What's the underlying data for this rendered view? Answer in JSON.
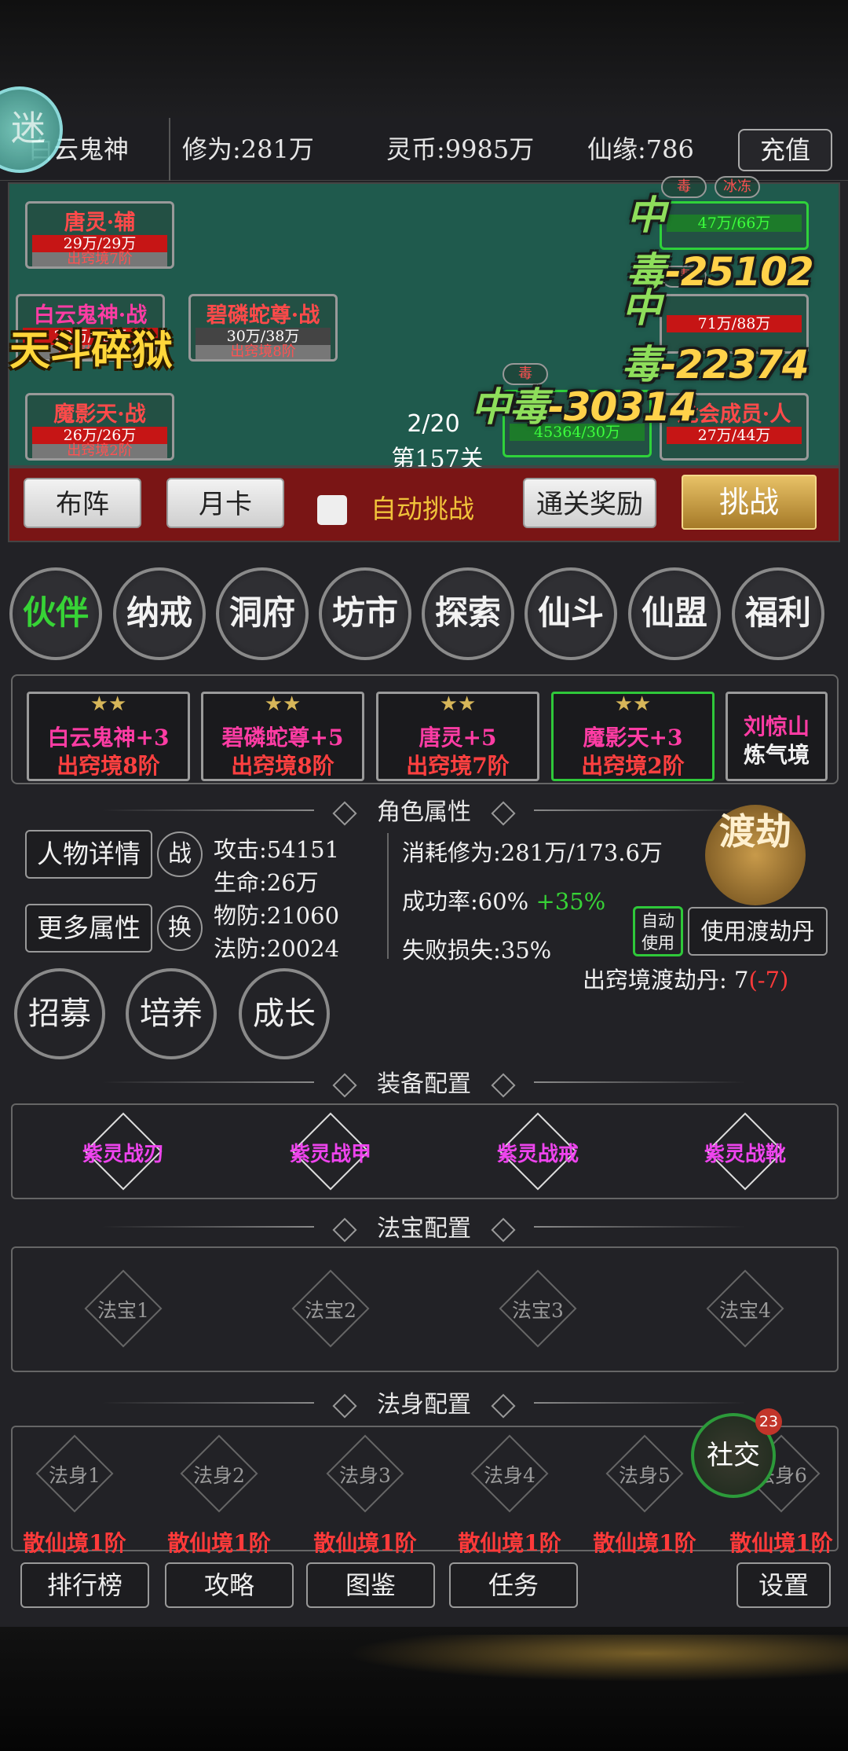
{
  "topbar": {
    "player_name": "白云鬼神",
    "cultivation": "修为:281万",
    "spirit_coin": "灵币:9985万",
    "fate": "仙缘:786",
    "recharge": "充值"
  },
  "avatar_logo": "迷",
  "battle": {
    "skill_text": "天斗碎狱",
    "wave": "2/20",
    "stage": "第157关",
    "allies": [
      {
        "name": "唐灵·辅",
        "hp": "29万/29万",
        "rank": "出窍境7阶"
      },
      {
        "name": "白云鬼神·战",
        "hp": "29万/29万",
        "rank": "出窍境8阶"
      },
      {
        "name": "碧磷蛇尊·战",
        "hp": "30万/38万",
        "rank": "出窍境8阶"
      },
      {
        "name": "魔影天·战",
        "hp": "26万/26万",
        "rank": "出窍境2阶"
      }
    ],
    "enemies": [
      {
        "name": "",
        "hp": "47万/66万",
        "tags": [
          "毒",
          "冰冻"
        ]
      },
      {
        "name": "",
        "hp": "71万/88万",
        "tags": [
          "毒"
        ]
      },
      {
        "name": "",
        "hp": "45364/30万",
        "tags": [
          "毒"
        ]
      },
      {
        "name": "龙会成员·人",
        "hp": "27万/44万",
        "tags": []
      }
    ],
    "damage": [
      {
        "prefix": "中毒",
        "value": "-25102"
      },
      {
        "prefix": "中毒",
        "value": "-22374"
      },
      {
        "prefix": "中毒",
        "value": "-30314"
      }
    ]
  },
  "controls": {
    "formation": "布阵",
    "monthly_card": "月卡",
    "auto_challenge": "自动挑战",
    "clear_reward": "通关奖励",
    "challenge": "挑战"
  },
  "menu": [
    "伙伴",
    "纳戒",
    "洞府",
    "坊市",
    "探索",
    "仙斗",
    "仙盟",
    "福利"
  ],
  "partners": [
    {
      "stars": "★★",
      "name": "白云鬼神+3",
      "rank": "出窍境8阶"
    },
    {
      "stars": "★★",
      "name": "碧磷蛇尊+5",
      "rank": "出窍境8阶"
    },
    {
      "stars": "★★",
      "name": "唐灵+5",
      "rank": "出窍境7阶"
    },
    {
      "stars": "★★",
      "name": "魔影天+3",
      "rank": "出窍境2阶"
    },
    {
      "stars": "",
      "name": "刘惊山",
      "rank": "炼气境"
    }
  ],
  "attributes": {
    "section_title": "角色属性",
    "detail_btn": "人物详情",
    "fight_btn": "战",
    "more_btn": "更多属性",
    "swap_btn": "换",
    "attack": "攻击:54151",
    "life": "生命:26万",
    "phys_def": "物防:21060",
    "magic_def": "法防:20024",
    "cost": "消耗修为:281万/173.6万",
    "success": "成功率:60%",
    "success_bonus": "+35%",
    "fail_loss": "失败损失:35%",
    "tribulation": "渡劫",
    "auto_use": "自动使用",
    "use_pill": "使用渡劫丹",
    "pill_label": "出窍境渡劫丹: ",
    "pill_count": "7",
    "pill_delta": "(-7)"
  },
  "actions": [
    "招募",
    "培养",
    "成长"
  ],
  "equipment": {
    "title": "装备配置",
    "items": [
      "紫灵战刃",
      "紫灵战甲",
      "紫灵战戒",
      "紫灵战靴"
    ]
  },
  "treasure": {
    "title": "法宝配置",
    "items": [
      "法宝1",
      "法宝2",
      "法宝3",
      "法宝4"
    ]
  },
  "body": {
    "title": "法身配置",
    "items": [
      {
        "name": "法身1",
        "rank": "散仙境1阶"
      },
      {
        "name": "法身2",
        "rank": "散仙境1阶"
      },
      {
        "name": "法身3",
        "rank": "散仙境1阶"
      },
      {
        "name": "法身4",
        "rank": "散仙境1阶"
      },
      {
        "name": "法身5",
        "rank": "散仙境1阶"
      },
      {
        "name": "法身6",
        "rank": "散仙境1阶"
      }
    ]
  },
  "social": {
    "label": "社交",
    "badge": "23"
  },
  "bottom": {
    "ranking": "排行榜",
    "guide": "攻略",
    "codex": "图鉴",
    "tasks": "任务",
    "settings": "设置"
  }
}
